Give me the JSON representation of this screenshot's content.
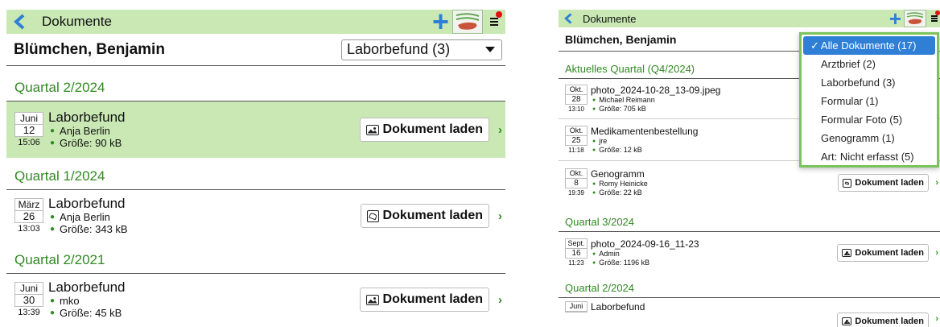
{
  "colors": {
    "accent_green": "#2f8a1f",
    "header_green": "#c9e8b4",
    "plus_blue": "#2f7fd6",
    "selected_blue": "#2f7fd6",
    "notify_red": "#e01010"
  },
  "left": {
    "header": {
      "title": "Dokumente"
    },
    "patient_name": "Blümchen, Benjamin",
    "filter_value": "Laborbefund (3)",
    "groups": [
      {
        "quarter": "Quartal 2/2024",
        "docs": [
          {
            "mon": "Juni",
            "day": "12",
            "time": "15:06",
            "title": "Laborbefund",
            "author": "Anja Berlin",
            "size": "Größe: 90 kB",
            "button": "Dokument laden",
            "icon": "image-icon"
          }
        ]
      },
      {
        "quarter": "Quartal 1/2024",
        "docs": [
          {
            "mon": "März",
            "day": "26",
            "time": "13:03",
            "title": "Laborbefund",
            "author": "Anja Berlin",
            "size": "Größe: 343 kB",
            "button": "Dokument laden",
            "icon": "pdf-icon"
          }
        ]
      },
      {
        "quarter": "Quartal 2/2021",
        "docs": [
          {
            "mon": "Juni",
            "day": "30",
            "time": "13:39",
            "title": "Laborbefund",
            "author": "mko",
            "size": "Größe: 45 kB",
            "button": "Dokument laden",
            "icon": "image-icon"
          }
        ]
      }
    ]
  },
  "right": {
    "header": {
      "title": "Dokumente"
    },
    "patient_name": "Blümchen, Benjamin",
    "groups": [
      {
        "quarter": "Aktuelles Quartal (Q4/2024)",
        "docs": [
          {
            "mon": "Okt.",
            "day": "28",
            "time": "13:10",
            "title": "photo_2024-10-28_13-09.jpeg",
            "author": "Michael Reimann",
            "size": "Größe: 705 kB"
          },
          {
            "mon": "Okt.",
            "day": "25",
            "time": "11:18",
            "title": "Medikamentenbestellung",
            "author": "jre",
            "size": "Größe: 12 kB"
          },
          {
            "mon": "Okt.",
            "day": "8",
            "time": "19:39",
            "title": "Genogramm",
            "author": "Romy Heinicke",
            "size": "Größe: 22 kB",
            "button": "Dokument laden",
            "icon": "pdf-icon"
          }
        ]
      },
      {
        "quarter": "Quartal 3/2024",
        "docs": [
          {
            "mon": "Sept.",
            "day": "16",
            "time": "11:23",
            "title": "photo_2024-09-16_11-23",
            "author": "Admin",
            "size": "Größe: 1196 kB",
            "button": "Dokument laden",
            "icon": "image-icon"
          }
        ]
      },
      {
        "quarter": "Quartal 2/2024",
        "docs": [
          {
            "mon": "Juni",
            "day": "",
            "time": "",
            "title": "Laborbefund",
            "author": "",
            "size": "",
            "button": "Dokument laden",
            "icon": "image-icon"
          }
        ]
      }
    ],
    "dropdown": {
      "check": "✓",
      "options": [
        "Alle Dokumente (17)",
        "Arztbrief (2)",
        "Laborbefund (3)",
        "Formular (1)",
        "Formular Foto (5)",
        "Genogramm (1)",
        "Art: Nicht erfasst (5)"
      ],
      "selected_index": 0
    }
  }
}
